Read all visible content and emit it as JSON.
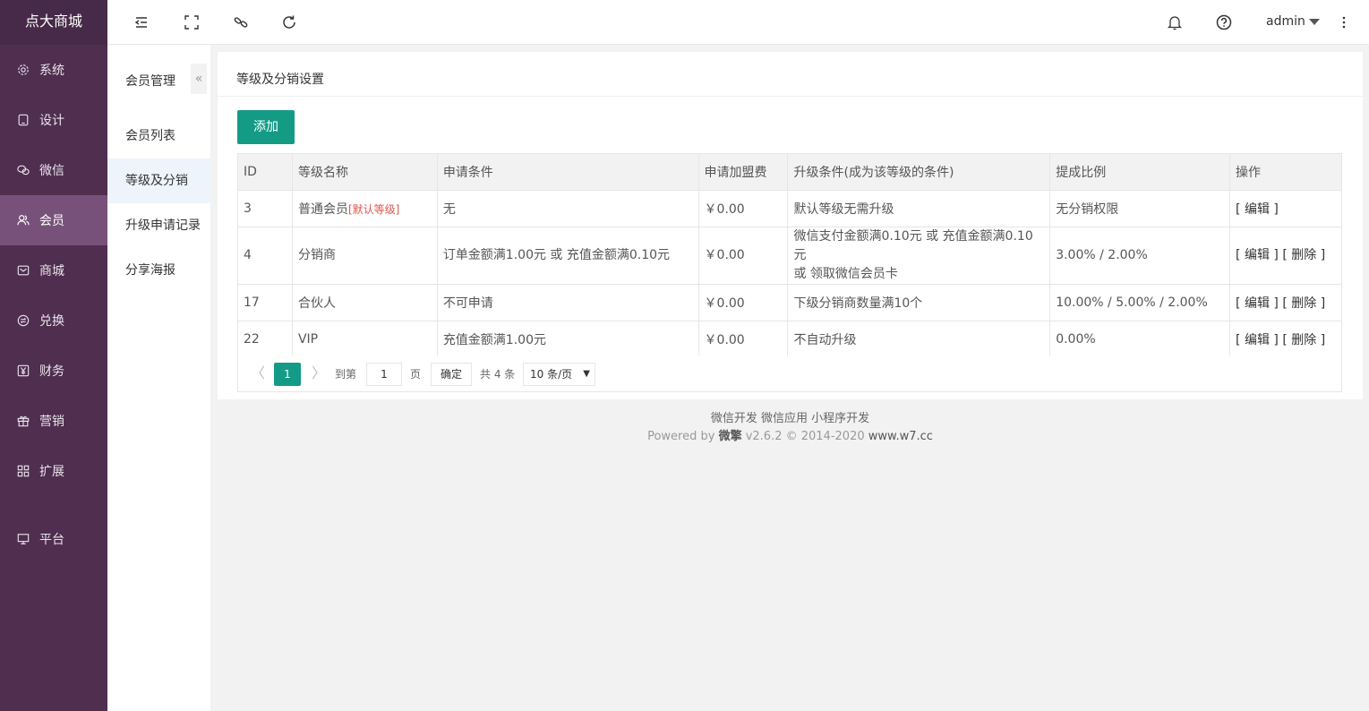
{
  "brand": "点大商城",
  "nav": [
    {
      "label": "系统",
      "icon": "gear-icon"
    },
    {
      "label": "设计",
      "icon": "tablet-icon"
    },
    {
      "label": "微信",
      "icon": "wechat-icon"
    },
    {
      "label": "会员",
      "icon": "user-group-icon",
      "active": true
    },
    {
      "label": "商城",
      "icon": "mail-icon"
    },
    {
      "label": "兑换",
      "icon": "exchange-icon"
    },
    {
      "label": "财务",
      "icon": "yen-icon"
    },
    {
      "label": "营销",
      "icon": "gift-icon"
    },
    {
      "label": "扩展",
      "icon": "grid-icon"
    },
    {
      "label": "平台",
      "icon": "monitor-icon"
    }
  ],
  "topbar": {
    "user": "admin",
    "icons": [
      "menu-fold-icon",
      "fullscreen-icon",
      "link-icon",
      "refresh-icon",
      "bell-icon",
      "help-icon",
      "more-icon"
    ]
  },
  "submenu": {
    "title": "会员管理",
    "collapse": "«",
    "items": [
      {
        "label": "会员列表"
      },
      {
        "label": "等级及分销",
        "active": true
      },
      {
        "label": "升级申请记录"
      },
      {
        "label": "分享海报"
      }
    ]
  },
  "page": {
    "title": "等级及分销设置",
    "add_label": "添加"
  },
  "table": {
    "headers": [
      "ID",
      "等级名称",
      "申请条件",
      "申请加盟费",
      "升级条件(成为该等级的条件)",
      "提成比例",
      "操作"
    ],
    "rows": [
      {
        "id": "3",
        "name": "普通会员",
        "tag": "[默认等级]",
        "apply": "无",
        "fee": "￥0.00",
        "upgrade": "默认等级无需升级",
        "upgrade2": "",
        "ratio": "无分销权限",
        "edit": "[ 编辑 ]",
        "del": ""
      },
      {
        "id": "4",
        "name": "分销商",
        "tag": "",
        "apply": "订单金额满1.00元 或 充值金额满0.10元",
        "fee": "￥0.00",
        "upgrade": "微信支付金额满0.10元 或 充值金额满0.10元",
        "upgrade2": "或 领取微信会员卡",
        "ratio": "3.00% / 2.00%",
        "edit": "[ 编辑 ]",
        "del": "[ 删除 ]"
      },
      {
        "id": "17",
        "name": "合伙人",
        "tag": "",
        "apply": "不可申请",
        "fee": "￥0.00",
        "upgrade": "下级分销商数量满10个",
        "upgrade2": "",
        "ratio": "10.00% / 5.00% / 2.00%",
        "edit": "[ 编辑 ]",
        "del": "[ 删除 ]"
      },
      {
        "id": "22",
        "name": "VIP",
        "tag": "",
        "apply": "充值金额满1.00元",
        "fee": "￥0.00",
        "upgrade": "不自动升级",
        "upgrade2": "",
        "ratio": "0.00%",
        "edit": "[ 编辑 ]",
        "del": "[ 删除 ]"
      }
    ]
  },
  "pager": {
    "prev": "〈",
    "current": "1",
    "next": "〉",
    "goto_label": "到第",
    "goto_value": "1",
    "page_unit": "页",
    "confirm": "确定",
    "total": "共 4 条",
    "page_size": "10 条/页",
    "page_size_arrow": "▼"
  },
  "footer": {
    "links": "微信开发 微信应用 小程序开发",
    "powered_prefix": "Powered by ",
    "powered_brand": "微擎",
    "powered_suffix": " v2.6.2 © 2014-2020 ",
    "site": "www.w7.cc"
  },
  "colors": {
    "sidebar": "#4f2e50",
    "sidebar_active": "#78517b",
    "accent": "#139b86",
    "tag_red": "#e0534a"
  }
}
